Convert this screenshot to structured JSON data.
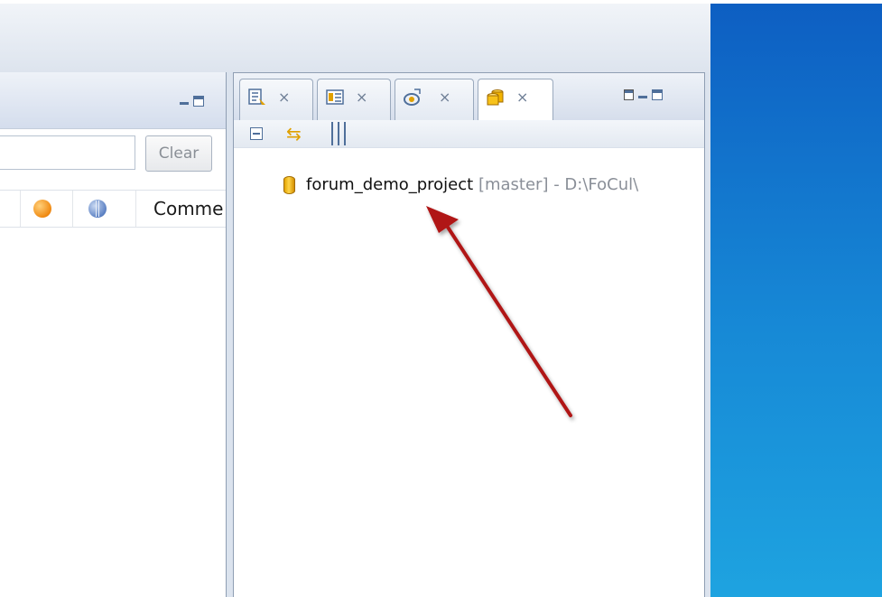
{
  "left_view": {
    "filter_value": "",
    "clear_label": "Clear",
    "column_label": "Comme"
  },
  "project_explorer": {
    "tab_icons": [
      "outline-icon",
      "database-structure-icon",
      "package-icon",
      "database-navigator-icon"
    ],
    "tab_close_glyph": "×",
    "tree_item": {
      "name": "forum_demo_project",
      "branch": "[master]",
      "path": "- D:\\FoCul\\"
    }
  },
  "colors": {
    "arrow": "#b01515",
    "desktop": "#1789d6"
  }
}
